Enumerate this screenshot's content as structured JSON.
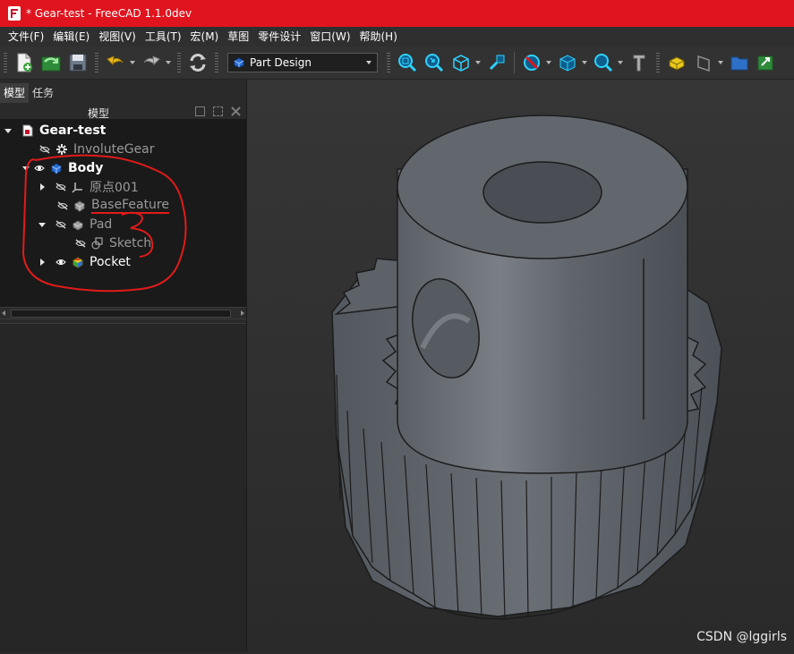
{
  "window": {
    "title": "* Gear-test - FreeCAD 1.1.0dev"
  },
  "menu": [
    "文件(F)",
    "编辑(E)",
    "视图(V)",
    "工具(T)",
    "宏(M)",
    "草图",
    "零件设计",
    "窗口(W)",
    "帮助(H)"
  ],
  "toolbar": {
    "workbench": "Part Design"
  },
  "panel": {
    "tabs": [
      "模型",
      "任务"
    ],
    "header_title": "模型"
  },
  "tree": {
    "items": [
      {
        "label": "Gear-test",
        "style": "bold",
        "icon": "document-icon",
        "expander": "open",
        "eye": ""
      },
      {
        "label": "InvoluteGear",
        "style": "dim",
        "icon": "gear-star-icon",
        "expander": "",
        "eye": "hidden"
      },
      {
        "label": "Body",
        "style": "bold",
        "icon": "body-icon",
        "expander": "open",
        "eye": "visible"
      },
      {
        "label": "原点001",
        "style": "dim",
        "icon": "origin-icon",
        "expander": "closed",
        "eye": "hidden"
      },
      {
        "label": "BaseFeature",
        "style": "dim",
        "icon": "basefeature-icon",
        "expander": "",
        "eye": "hidden"
      },
      {
        "label": "Pad",
        "style": "dim",
        "icon": "pad-icon",
        "expander": "open",
        "eye": "hidden"
      },
      {
        "label": "Sketch",
        "style": "dim",
        "icon": "sketch-icon",
        "expander": "",
        "eye": "hidden"
      },
      {
        "label": "Pocket",
        "style": "bright",
        "icon": "pocket-icon",
        "expander": "closed",
        "eye": "visible"
      }
    ]
  },
  "watermark": "CSDN @lggirls",
  "colors": {
    "titlebar": "#e0141e",
    "annotation": "#e01b1b",
    "gear": "#5d6268"
  }
}
